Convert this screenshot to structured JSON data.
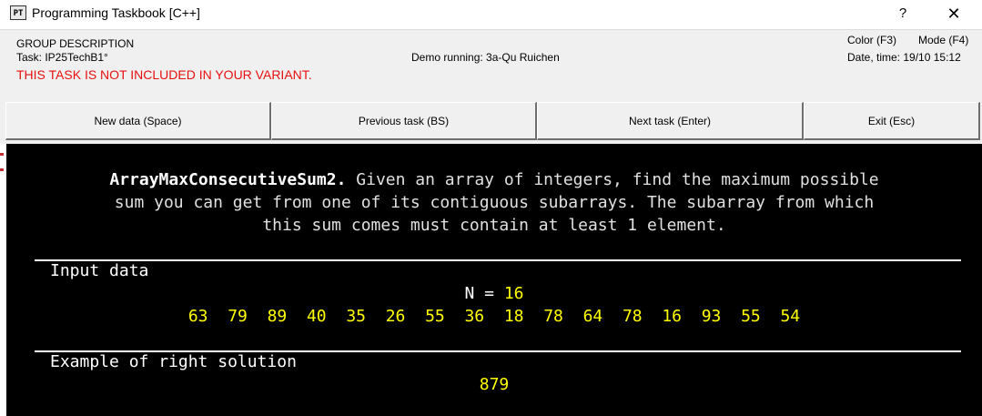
{
  "window": {
    "title": "Programming Taskbook [C++]",
    "icon_text": "PT",
    "help_label": "?",
    "close_label": "✕"
  },
  "info": {
    "group_description": "GROUP DESCRIPTION",
    "task": "Task: IP25TechB1°",
    "warning": "THIS TASK IS NOT INCLUDED IN YOUR VARIANT.",
    "demo": "Demo running: 3a-Qu Ruichen",
    "color_label": "Color (F3)",
    "mode_label": "Mode (F4)",
    "datetime": "Date, time: 19/10 15:12",
    "warning_color": "#e8100f"
  },
  "buttons": {
    "new_data": "New data (Space)",
    "previous_task": "Previous task (BS)",
    "next_task": "Next task (Enter)",
    "exit": "Exit (Esc)"
  },
  "console": {
    "function_name": "ArrayMaxConsecutiveSum2.",
    "desc_line1_rest": " Given an array of integers, find the maximum possible",
    "desc_line2": "sum you can get from one of its contiguous subarrays. The subarray from which",
    "desc_line3": "this sum comes must contain at least 1 element.",
    "input_title": "Input data",
    "n_label": "N = ",
    "n_value": "16",
    "numbers": [
      63,
      79,
      89,
      40,
      35,
      26,
      55,
      36,
      18,
      78,
      64,
      78,
      16,
      93,
      55,
      54
    ],
    "example_title": "Example of right solution",
    "result": "879",
    "accent_color": "#ffff00",
    "background_color": "#000000"
  }
}
